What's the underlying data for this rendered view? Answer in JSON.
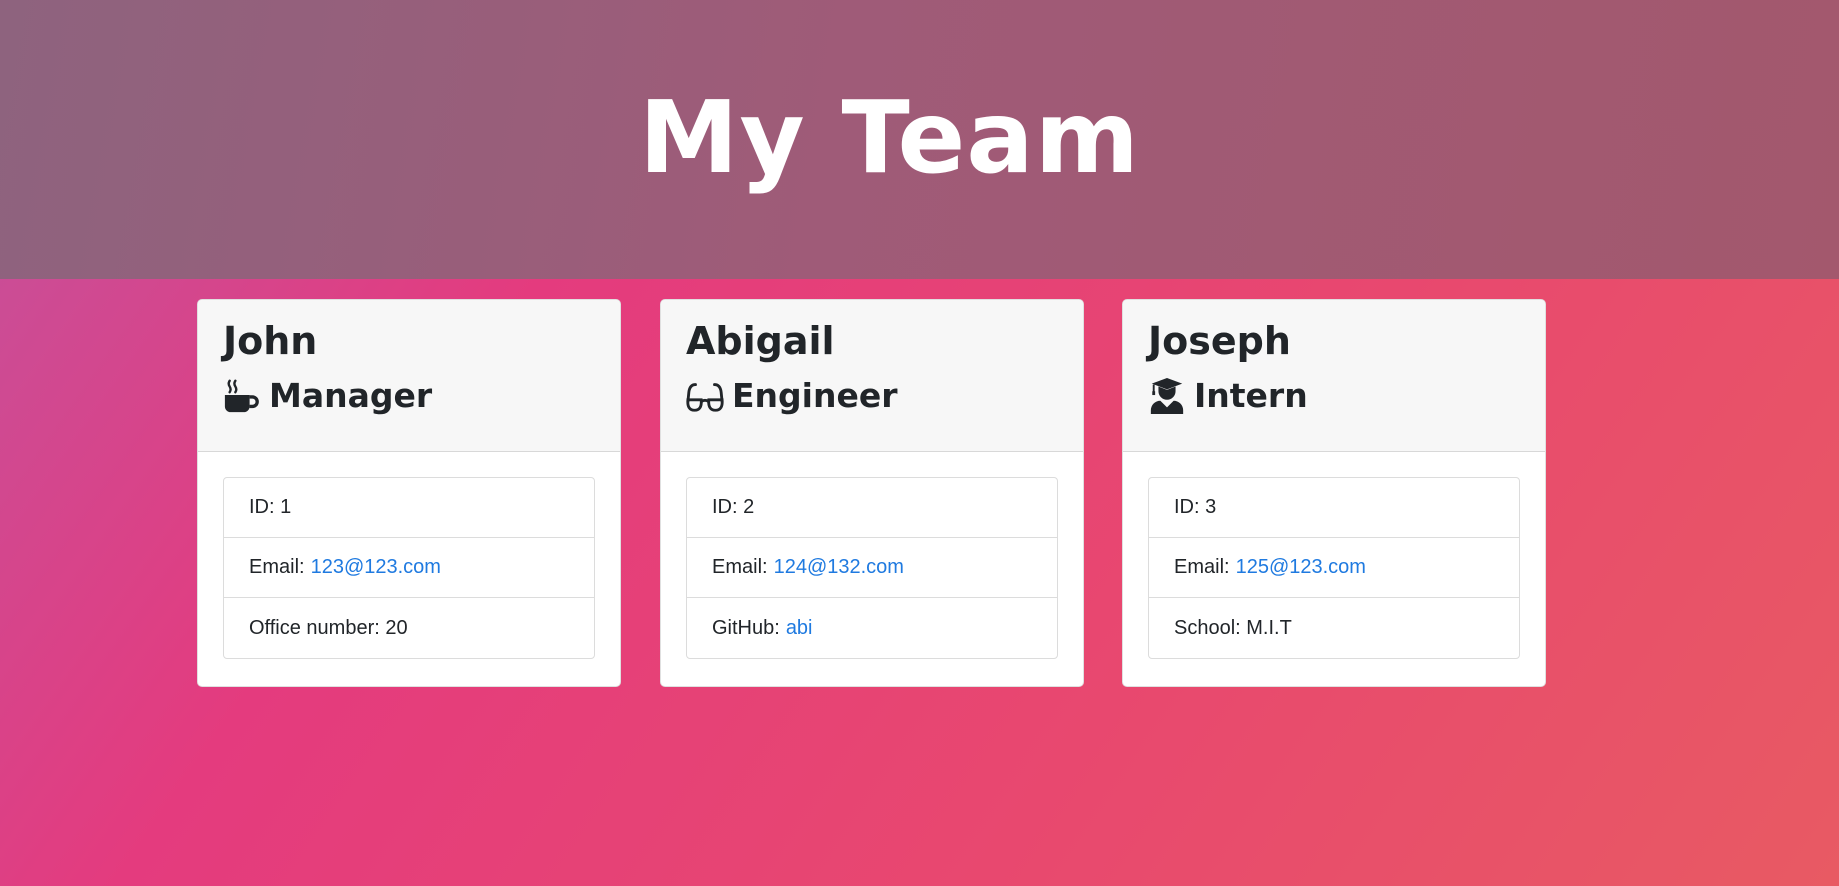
{
  "header": {
    "title": "My Team"
  },
  "cards": [
    {
      "name": "John",
      "role": "Manager",
      "role_icon": "mug-hot-icon",
      "id_label": "ID: 1",
      "email_label": "Email:",
      "email": "123@123.com",
      "extra_label": "Office number: 20",
      "extra_link": ""
    },
    {
      "name": "Abigail",
      "role": "Engineer",
      "role_icon": "glasses-icon",
      "id_label": "ID: 2",
      "email_label": "Email:",
      "email": "124@132.com",
      "extra_label": "GitHub:",
      "extra_link": "abi"
    },
    {
      "name": "Joseph",
      "role": "Intern",
      "role_icon": "user-graduate-icon",
      "id_label": "ID: 3",
      "email_label": "Email:",
      "email": "125@123.com",
      "extra_label": "School: M.I.T",
      "extra_link": ""
    }
  ],
  "colors": {
    "link": "#1f7ae0",
    "text": "#212529",
    "header_bg": "#9f5b78",
    "page_bg": "#e43b7e"
  }
}
